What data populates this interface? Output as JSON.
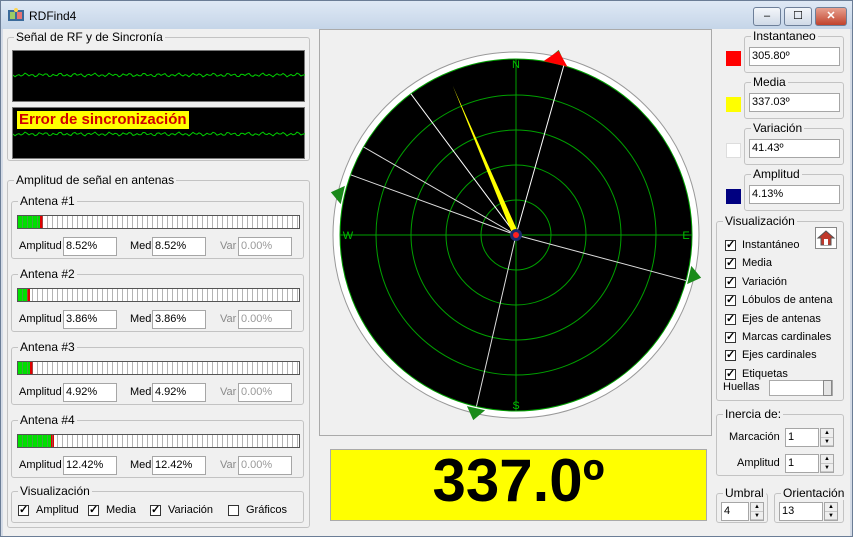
{
  "window": {
    "title": "RDFind4",
    "minimize": "–",
    "maximize": "☐",
    "close": "✕"
  },
  "rf_panel": {
    "title": "Señal de RF y de Sincronía",
    "error_text": "Error de sincronización"
  },
  "amp_panel": {
    "title": "Amplitud de señal en antenas",
    "amp_label": "Amplitud",
    "med_label": "Med",
    "var_label": "Var",
    "antennas": [
      {
        "name": "Antena #1",
        "amplitud": "8.52%",
        "med": "8.52%",
        "var": "0.00%",
        "level": 0.0852
      },
      {
        "name": "Antena #2",
        "amplitud": "3.86%",
        "med": "3.86%",
        "var": "0.00%",
        "level": 0.0386
      },
      {
        "name": "Antena #3",
        "amplitud": "4.92%",
        "med": "4.92%",
        "var": "0.00%",
        "level": 0.0492
      },
      {
        "name": "Antena #4",
        "amplitud": "12.42%",
        "med": "12.42%",
        "var": "0.00%",
        "level": 0.1242
      }
    ],
    "vis_title": "Visualización",
    "vis_items": [
      "Amplitud",
      "Media",
      "Variación",
      "Gráficos"
    ]
  },
  "compass": {
    "n": "N",
    "e": "E",
    "s": "S",
    "w": "W"
  },
  "readings": [
    {
      "label": "Instantaneo",
      "value": "305.80º",
      "color": "#ff0000"
    },
    {
      "label": "Media",
      "value": "337.03º",
      "color": "#ffff00"
    },
    {
      "label": "Variación",
      "value": "41.43º",
      "color": "#ffffff"
    },
    {
      "label": "Amplitud",
      "value": "4.13%",
      "color": "#000080"
    }
  ],
  "visualizacion": {
    "title": "Visualización",
    "items": [
      "Instantáneo",
      "Media",
      "Variación",
      "Lóbulos de antena",
      "Ejes de antenas",
      "Marcas cardinales",
      "Ejes cardinales",
      "Etiquetas"
    ],
    "huellas_label": "Huellas"
  },
  "inercia": {
    "title": "Inercia de:",
    "marcacion_label": "Marcación",
    "marcacion_value": "1",
    "amplitud_label": "Amplitud",
    "amplitud_value": "1"
  },
  "umbral": {
    "title": "Umbral",
    "value": "4"
  },
  "orientacion": {
    "title": "Orientación",
    "value": "13"
  },
  "bearing_display": "337.0º"
}
